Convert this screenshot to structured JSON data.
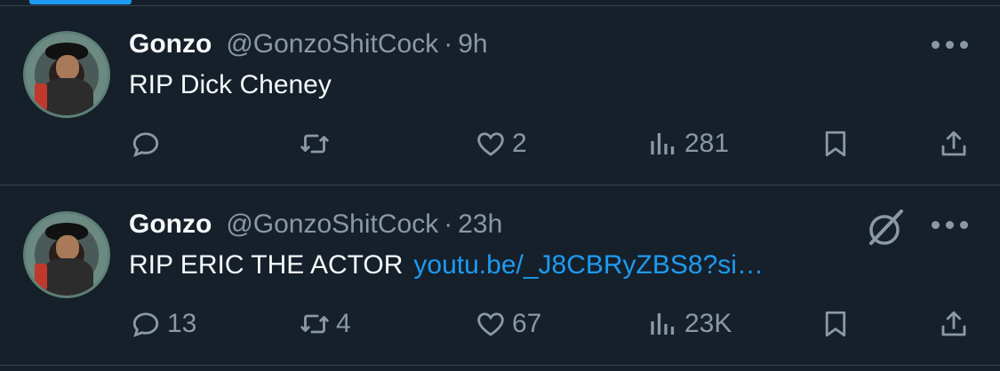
{
  "tweets": [
    {
      "name": "Gonzo",
      "handle": "@GonzoShitCock",
      "separator": "·",
      "time": "9h",
      "text": "RIP Dick Cheney",
      "link": "",
      "replies": "",
      "retweets": "",
      "likes": "2",
      "views": "281"
    },
    {
      "name": "Gonzo",
      "handle": "@GonzoShitCock",
      "separator": "·",
      "time": "23h",
      "text": "RIP ERIC THE ACTOR",
      "link": "youtu.be/_J8CBRyZBS8?si…",
      "replies": "13",
      "retweets": "4",
      "likes": "67",
      "views": "23K"
    }
  ],
  "colors": {
    "background": "#15202b",
    "text": "#f7f9f9",
    "muted": "#8b98a5",
    "accent": "#1d9bf0",
    "divider": "#38444d"
  },
  "icons": [
    "reply-icon",
    "retweet-icon",
    "like-icon",
    "views-icon",
    "bookmark-icon",
    "share-icon",
    "more-icon",
    "grok-icon"
  ]
}
